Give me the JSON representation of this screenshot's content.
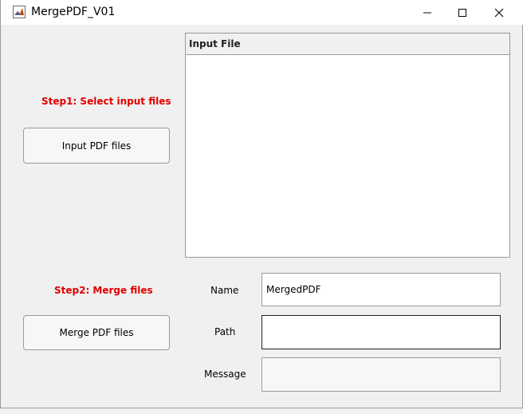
{
  "window": {
    "title": "MergePDF_V01",
    "app_icon": "matlab-icon",
    "controls": [
      "minimize-icon",
      "maximize-icon",
      "close-icon"
    ]
  },
  "step1": {
    "label": "Step1:  Select input files",
    "button_label": "Input PDF files"
  },
  "step2": {
    "label": "Step2:  Merge files",
    "button_label": "Merge PDF files"
  },
  "file_list": {
    "header": "Input File",
    "items": []
  },
  "fields": {
    "name_label": "Name",
    "name_value": "MergedPDF",
    "path_label": "Path",
    "path_value": "",
    "message_label": "Message",
    "message_value": ""
  },
  "colors": {
    "step_label": "#e00000",
    "background": "#f0f0f0"
  }
}
